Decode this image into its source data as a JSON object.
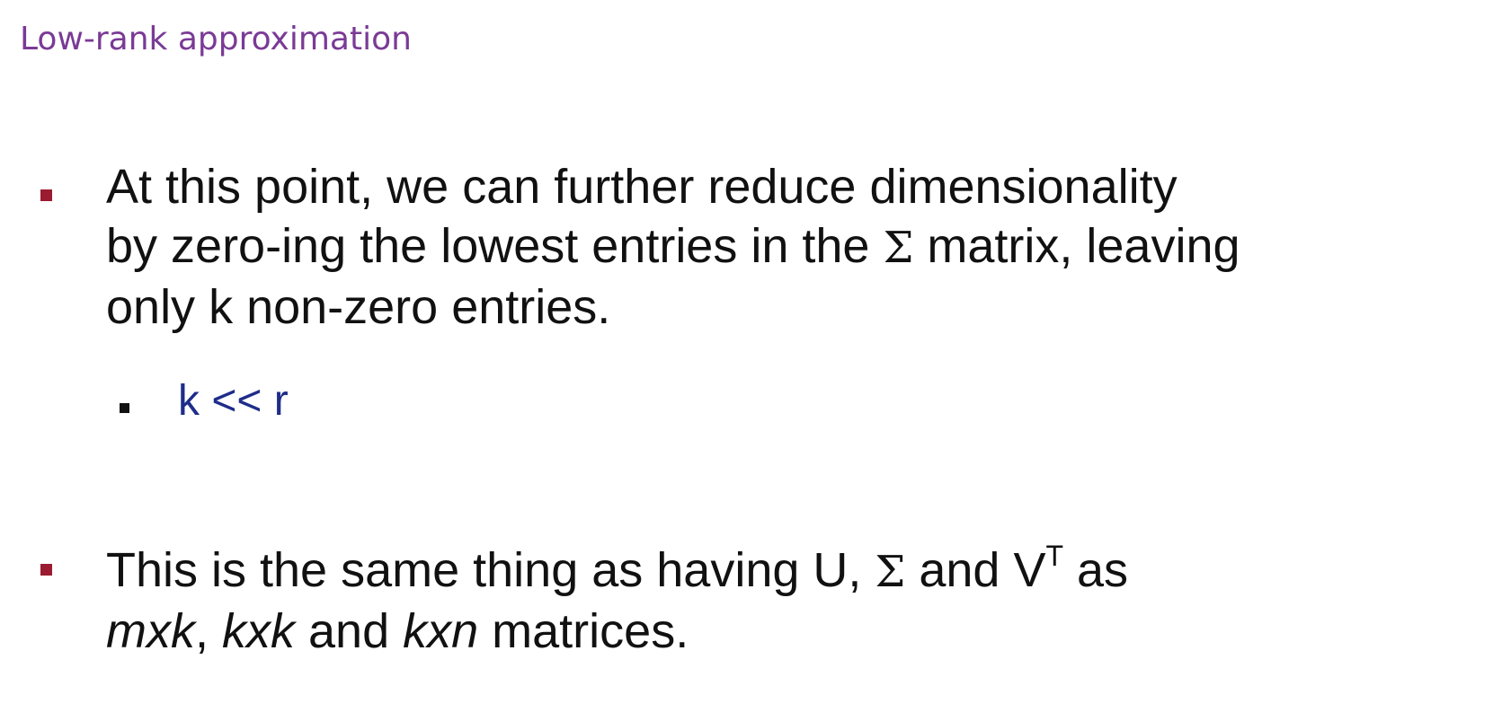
{
  "slide": {
    "title": "Low-rank approximation",
    "bullet1": {
      "line1": "At  this point, we can further reduce dimensionality",
      "line2_pre": "by zero-ing the lowest entries in the ",
      "sigma": "Σ",
      "line2_post": " matrix, leaving",
      "line3": "only k non-zero entries."
    },
    "sub_bullet": "k << r",
    "bullet2": {
      "pre": "This is the same thing as having U, ",
      "sigma": "Σ",
      "mid": " and V",
      "sup": "T",
      "post": " as",
      "mxk": "mxk",
      "comma": ", ",
      "kxk": "kxk",
      "and": " and ",
      "kxn": "kxn",
      "tail": " matrices."
    }
  },
  "colors": {
    "title": "#7a3a96",
    "bullet_marker": "#9b1b30",
    "sub_bullet_text": "#1e2d8a"
  }
}
